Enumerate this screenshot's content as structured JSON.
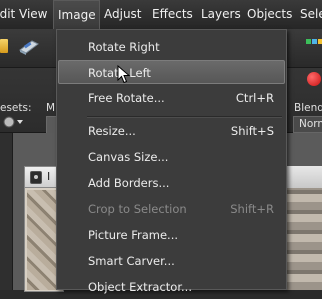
{
  "menubar": {
    "items": [
      {
        "label": "Edit"
      },
      {
        "label": "View"
      },
      {
        "label": "Image"
      },
      {
        "label": "Adjust"
      },
      {
        "label": "Effects"
      },
      {
        "label": "Layers"
      },
      {
        "label": "Objects"
      },
      {
        "label": "Sele"
      }
    ]
  },
  "options": {
    "presets_label": "esets:",
    "left_label": "M",
    "blend_label": "Blend r",
    "blend_value": "Norm"
  },
  "image_window": {
    "title": "I"
  },
  "image_menu": {
    "items": [
      {
        "label": "Rotate Right",
        "shortcut": ""
      },
      {
        "label": "Rotate Left",
        "shortcut": ""
      },
      {
        "label": "Free Rotate...",
        "shortcut": "Ctrl+R"
      },
      {
        "label": "Resize...",
        "shortcut": "Shift+S"
      },
      {
        "label": "Canvas Size...",
        "shortcut": ""
      },
      {
        "label": "Add Borders...",
        "shortcut": ""
      },
      {
        "label": "Crop to Selection",
        "shortcut": "Shift+R"
      },
      {
        "label": "Picture Frame...",
        "shortcut": ""
      },
      {
        "label": "Smart Carver...",
        "shortcut": ""
      },
      {
        "label": "Object Extractor...",
        "shortcut": ""
      }
    ]
  },
  "colors": {
    "menu_bg": "#3c3c3c",
    "highlight": "#5f5f5f",
    "disabled_text": "#8a8a8a",
    "accent_red": "#e02020"
  }
}
